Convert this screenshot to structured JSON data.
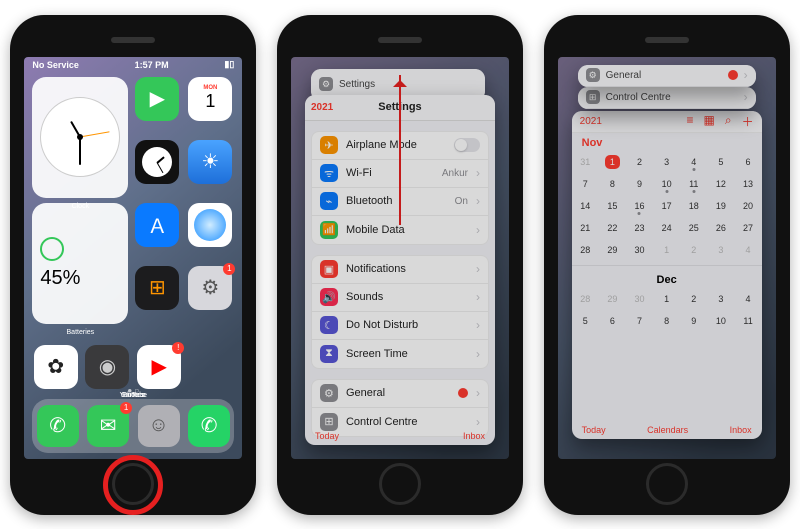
{
  "status": {
    "carrier": "No Service",
    "time": "1:57 PM"
  },
  "home": {
    "clock_widget_label": "Clock",
    "batteries_widget_label": "Batteries",
    "battery_pct": "45%",
    "apps": {
      "facetime": "FaceTime",
      "calendar": "Calendar",
      "calendar_day": "MON",
      "calendar_date": "1",
      "clock": "Clock",
      "weather": "Weather",
      "appstore": "App Store",
      "safari": "Safari",
      "calculator": "Calculator",
      "settings": "Settings",
      "photos": "Photos",
      "camera": "Camera",
      "youtube": "YouTube"
    },
    "dock": {
      "phone": "Phone",
      "messages": "Messages",
      "contacts": "Contacts",
      "whatsapp": "WhatsApp"
    },
    "badge_messages": "1",
    "badge_settings": "1"
  },
  "switcher1": {
    "header_icon_label": "Settings",
    "nav_back": "2021",
    "nav_title": "Settings",
    "groups": [
      [
        {
          "icon": "✈",
          "bg": "#ff9500",
          "label": "Airplane Mode",
          "value": "",
          "toggle": true
        },
        {
          "icon": "ᯤ",
          "bg": "#0a7aff",
          "label": "Wi-Fi",
          "value": "Ankur"
        },
        {
          "icon": "⌁",
          "bg": "#0a7aff",
          "label": "Bluetooth",
          "value": "On"
        },
        {
          "icon": "📶",
          "bg": "#34c759",
          "label": "Mobile Data",
          "value": ""
        }
      ],
      [
        {
          "icon": "▣",
          "bg": "#ff3b30",
          "label": "Notifications",
          "value": ""
        },
        {
          "icon": "🔊",
          "bg": "#ff2d55",
          "label": "Sounds",
          "value": ""
        },
        {
          "icon": "☾",
          "bg": "#5856d6",
          "label": "Do Not Disturb",
          "value": ""
        },
        {
          "icon": "⧗",
          "bg": "#5856d6",
          "label": "Screen Time",
          "value": ""
        }
      ],
      [
        {
          "icon": "⚙",
          "bg": "#8e8e93",
          "label": "General",
          "value": "",
          "badge": true
        },
        {
          "icon": "⊞",
          "bg": "#8e8e93",
          "label": "Control Centre",
          "value": ""
        }
      ]
    ],
    "bottom": {
      "left": "Today",
      "right": "Inbox"
    }
  },
  "switcher2": {
    "header_general": "General",
    "header_control": "Control Centre",
    "cal_back": "2021",
    "toolbar": [
      "≡",
      "▦",
      "⌕",
      "＋"
    ],
    "month1": "Nov",
    "nov_start_blank": 1,
    "nov_days": 30,
    "nov_today": 1,
    "nov_dots": [
      4,
      10,
      11,
      16
    ],
    "month2": "Dec",
    "dec_row": [
      28,
      29,
      30,
      1,
      2,
      3,
      4
    ],
    "dec_row2": [
      5,
      6,
      7,
      8,
      9,
      10,
      11
    ],
    "bottom": {
      "left": "Today",
      "mid": "Calendars",
      "right": "Inbox"
    }
  }
}
